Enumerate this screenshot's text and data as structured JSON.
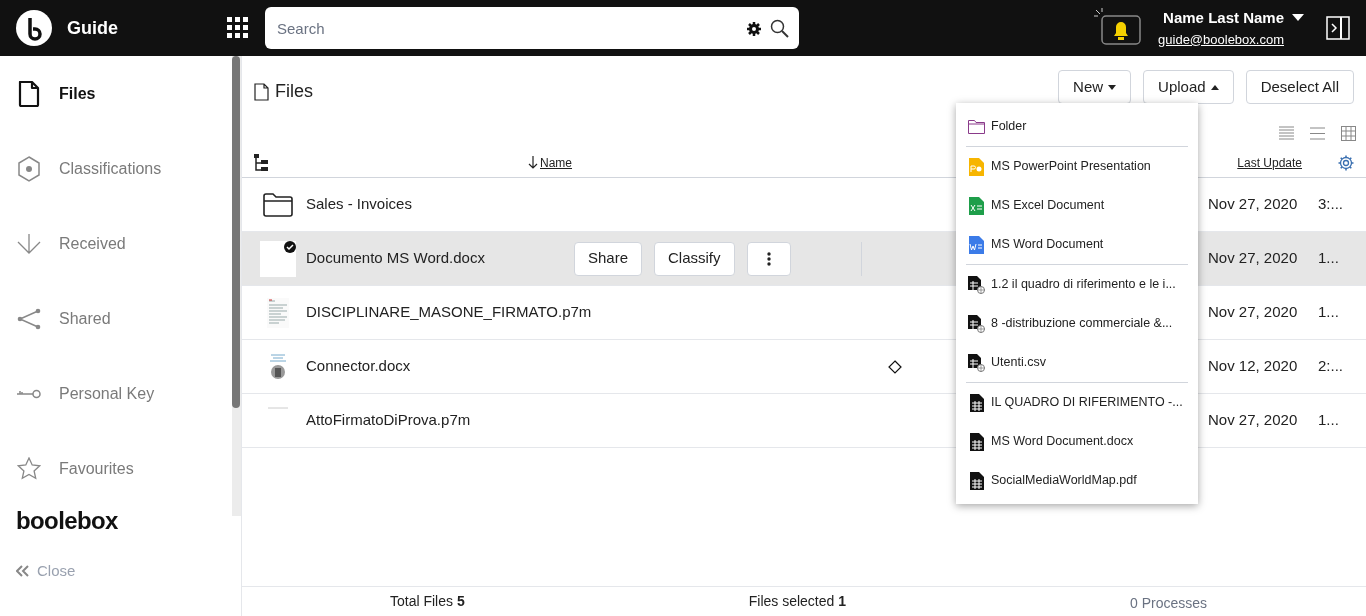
{
  "header": {
    "app_title": "Guide",
    "search": {
      "placeholder": "Search"
    },
    "user": {
      "name": "Name Last Name",
      "email": "guide@boolebox.com"
    }
  },
  "sidebar": {
    "items": [
      {
        "label": "Files",
        "selected": true
      },
      {
        "label": "Classifications",
        "selected": false
      },
      {
        "label": "Received",
        "selected": false
      },
      {
        "label": "Shared",
        "selected": false
      },
      {
        "label": "Personal Key",
        "selected": false
      },
      {
        "label": "Favourites",
        "selected": false
      }
    ],
    "logo": "boolebox",
    "close": "Close"
  },
  "page": {
    "title": "Files",
    "buttons": [
      {
        "label": "New",
        "dropdown": true,
        "open": false
      },
      {
        "label": "Upload",
        "dropdown": true,
        "open": true
      },
      {
        "label": "Deselect All",
        "dropdown": false
      }
    ]
  },
  "table": {
    "columns": [
      {
        "label": "Name",
        "sorted": true
      },
      {
        "label": "Last Update"
      }
    ],
    "rows": [
      {
        "kind": "folder",
        "name": "Sales - Invoices",
        "date": "Nov 27, 2020",
        "time": "3:...",
        "selected": false,
        "marked": false
      },
      {
        "kind": "checked",
        "name": "Documento MS Word.docx",
        "date": "Nov 27, 2020",
        "time": "1...",
        "selected": true,
        "marked": false,
        "actions": [
          "Share",
          "Classify"
        ]
      },
      {
        "kind": "doc",
        "name": "DISCIPLINARE_MASONE_FIRMATO.p7m",
        "date": "Nov 27, 2020",
        "time": "1...",
        "selected": false,
        "marked": false
      },
      {
        "kind": "photo",
        "name": "Connector.docx",
        "date": "Nov 12, 2020",
        "time": "2:...",
        "selected": false,
        "marked": true
      },
      {
        "kind": "blank",
        "name": "AttoFirmatoDiProva.p7m",
        "date": "Nov 27, 2020",
        "time": "1...",
        "selected": false,
        "marked": false
      }
    ]
  },
  "menu": {
    "groups": [
      [
        {
          "kind": "folder",
          "label": "Folder"
        }
      ],
      [
        {
          "kind": "ppt",
          "label": "MS PowerPoint Presentation"
        },
        {
          "kind": "excel",
          "label": "MS Excel Document"
        },
        {
          "kind": "word",
          "label": "MS Word Document"
        }
      ],
      [
        {
          "kind": "template",
          "label": "1.2 il quadro di riferimento e le i..."
        },
        {
          "kind": "template",
          "label": "8 -distribuzione commerciale &..."
        },
        {
          "kind": "template",
          "label": "Utenti.csv"
        }
      ],
      [
        {
          "kind": "file",
          "label": "IL QUADRO DI RIFERIMENTO -..."
        },
        {
          "kind": "file",
          "label": "MS Word Document.docx"
        },
        {
          "kind": "file",
          "label": "SocialMediaWorldMap.pdf"
        }
      ]
    ]
  },
  "status_bar": {
    "total": "Total Files **5**",
    "selected": "Files selected **1**",
    "processes": "0 Processes"
  }
}
